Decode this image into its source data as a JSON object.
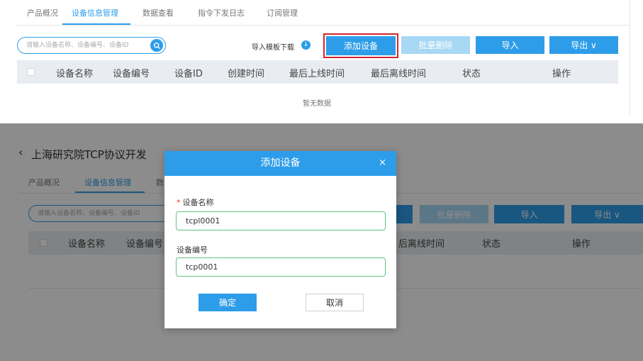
{
  "top_panel": {
    "tabs": [
      {
        "label": "产品概况",
        "active": false
      },
      {
        "label": "设备信息管理",
        "active": true
      },
      {
        "label": "数据查看",
        "active": false
      },
      {
        "label": "指令下发日志",
        "active": false
      },
      {
        "label": "订阅管理",
        "active": false
      }
    ],
    "search_placeholder": "请输入设备名称、设备编号、设备ID",
    "template_download": "导入模板下载",
    "buttons": {
      "add": "添加设备",
      "batch_delete": "批量删除",
      "import": "导入",
      "export": "导出 ∨"
    },
    "table_headers": [
      "设备名称",
      "设备编号",
      "设备ID",
      "创建时间",
      "最后上线时间",
      "最后离线时间",
      "状态",
      "操作"
    ],
    "empty_text": "暂无数据"
  },
  "bottom_panel": {
    "page_title": "上海研究院TCP协议开发",
    "tabs_visible": [
      "产品概况",
      "设备信息管理",
      "数"
    ],
    "search_placeholder": "请输入设备名称、设备编号、设备ID",
    "buttons": {
      "batch_delete": "批量删除",
      "import": "导入",
      "export": "导出 ∨"
    },
    "headers_left": [
      "设备名称",
      "设备编号"
    ],
    "headers_right": [
      "后离线时间",
      "状态",
      "操作"
    ]
  },
  "modal": {
    "title": "添加设备",
    "close_glyph": "×",
    "fields": [
      {
        "label": "设备名称",
        "required": true,
        "value": "tcpl0001"
      },
      {
        "label": "设备编号",
        "required": false,
        "value": "tcp0001"
      }
    ],
    "confirm": "确定",
    "cancel": "取消"
  },
  "colors": {
    "primary": "#2e9de9",
    "disabled": "#a7d8f4",
    "focus_border": "#d8232a",
    "valid_border": "#5ec37d"
  }
}
